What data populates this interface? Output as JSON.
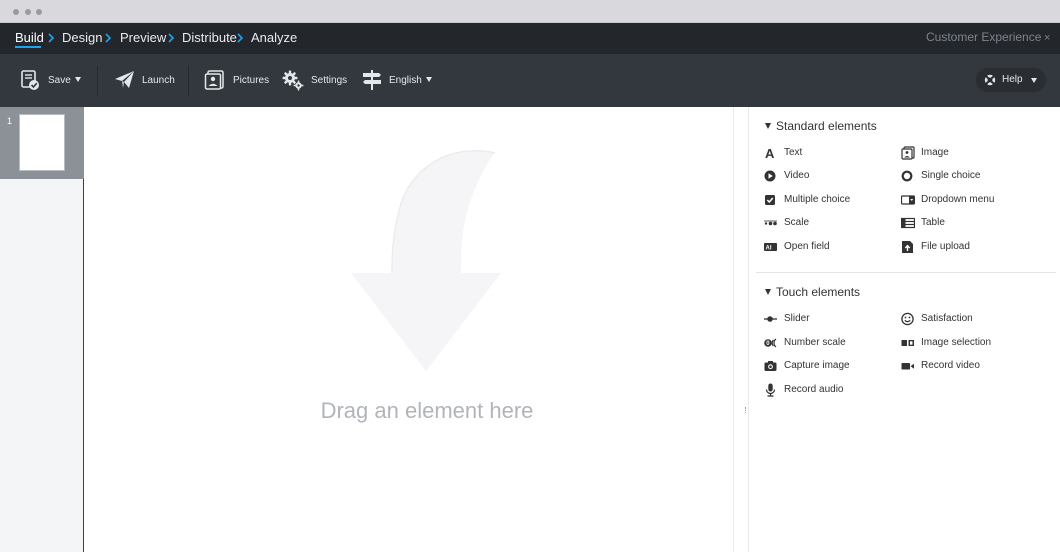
{
  "nav": {
    "steps": [
      "Build",
      "Design",
      "Preview",
      "Distribute",
      "Analyze"
    ],
    "brand": "Customer Experience",
    "close": "×"
  },
  "toolbar": {
    "save": "Save",
    "launch": "Launch",
    "pictures": "Pictures",
    "settings": "Settings",
    "language": "English",
    "help": "Help"
  },
  "pages": {
    "items": [
      "1"
    ]
  },
  "canvas": {
    "drop_text": "Drag an element here"
  },
  "panel": {
    "standard": {
      "title": "Standard elements",
      "items": [
        {
          "label": "Text",
          "icon": "text-icon"
        },
        {
          "label": "Image",
          "icon": "image-icon"
        },
        {
          "label": "Video",
          "icon": "video-icon"
        },
        {
          "label": "Single choice",
          "icon": "single-choice-icon"
        },
        {
          "label": "Multiple choice",
          "icon": "multiple-choice-icon"
        },
        {
          "label": "Dropdown menu",
          "icon": "dropdown-icon"
        },
        {
          "label": "Scale",
          "icon": "scale-icon"
        },
        {
          "label": "Table",
          "icon": "table-icon"
        },
        {
          "label": "Open field",
          "icon": "open-field-icon"
        },
        {
          "label": "File upload",
          "icon": "file-upload-icon"
        }
      ]
    },
    "touch": {
      "title": "Touch elements",
      "items": [
        {
          "label": "Slider",
          "icon": "slider-icon"
        },
        {
          "label": "Satisfaction",
          "icon": "satisfaction-icon"
        },
        {
          "label": "Number scale",
          "icon": "number-scale-icon"
        },
        {
          "label": "Image selection",
          "icon": "image-selection-icon"
        },
        {
          "label": "Capture image",
          "icon": "camera-icon"
        },
        {
          "label": "Record video",
          "icon": "record-video-icon"
        },
        {
          "label": "Record audio",
          "icon": "microphone-icon"
        }
      ]
    }
  },
  "colors": {
    "nav_bg": "#23272c",
    "toolbar_bg": "#33383e",
    "accent": "#1fa3ea",
    "page_selected": "#8c9097"
  }
}
